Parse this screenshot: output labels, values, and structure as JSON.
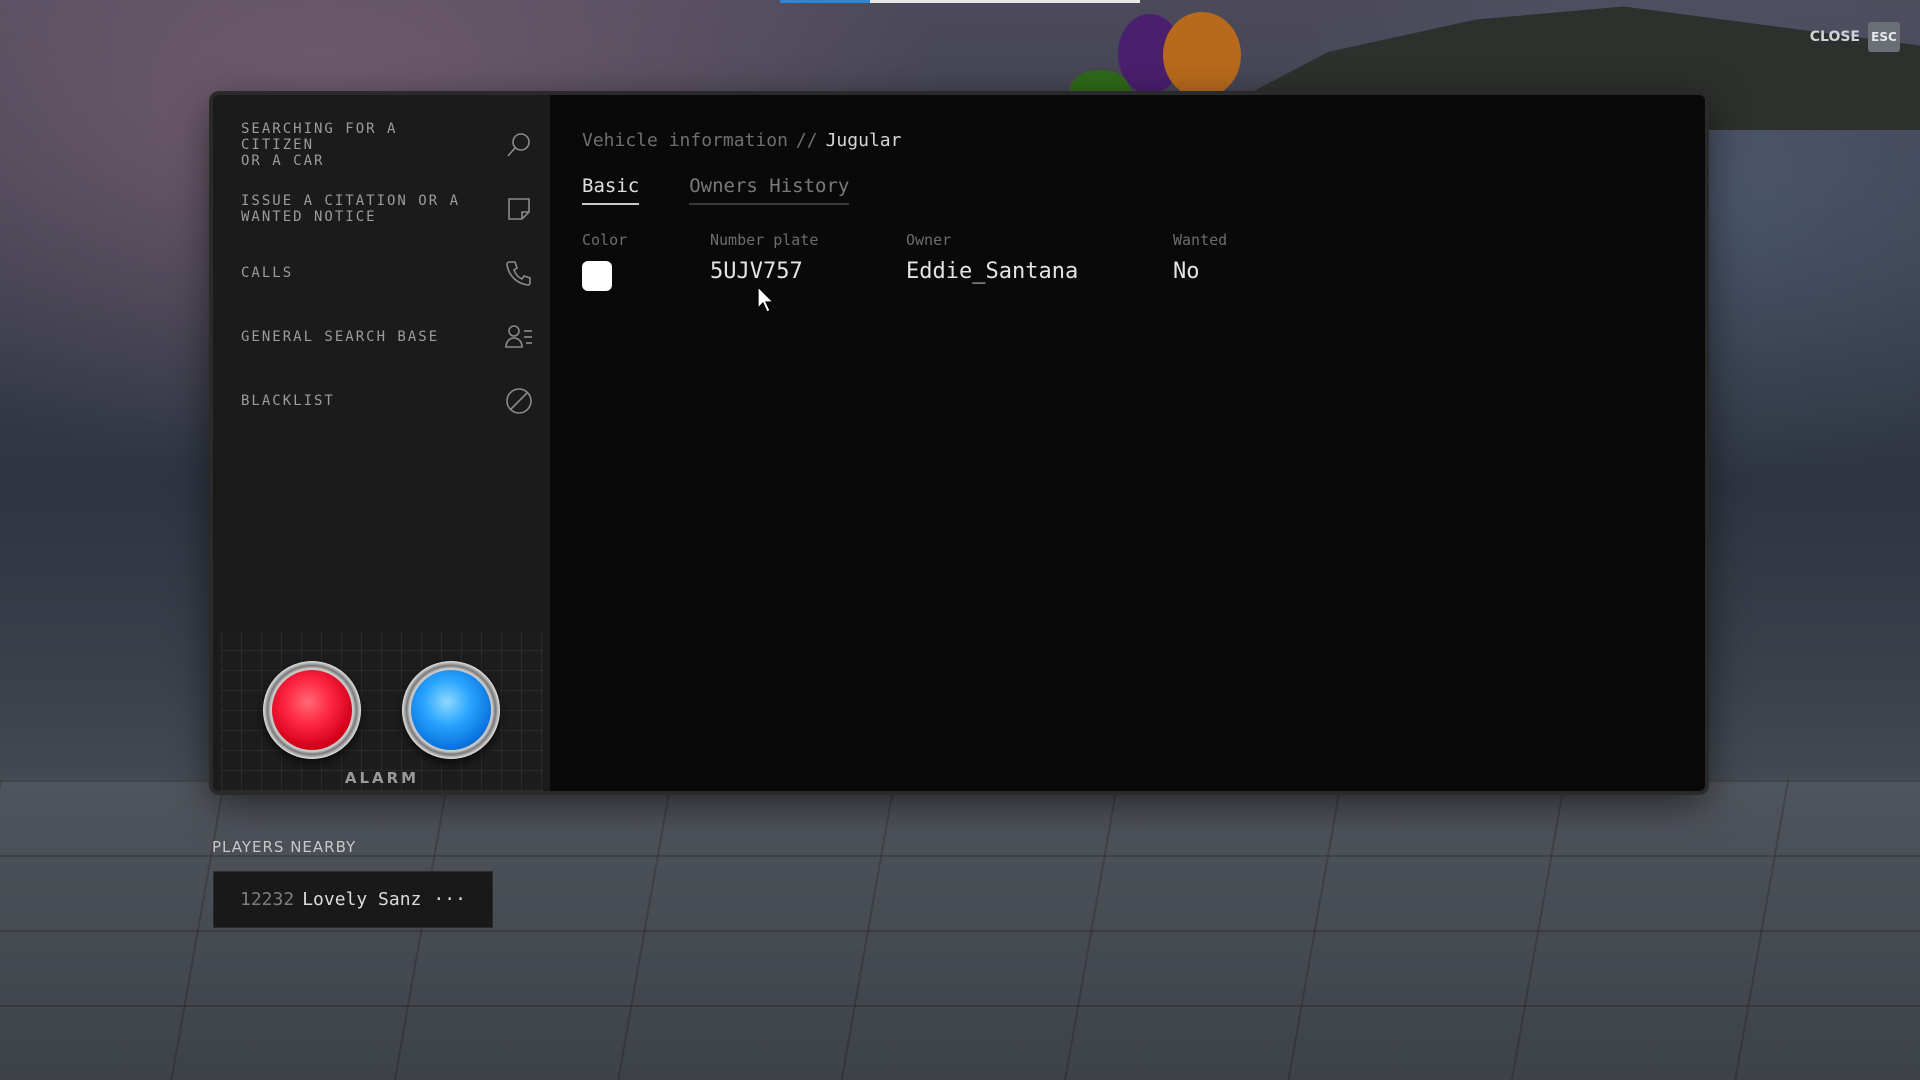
{
  "top_progress": {
    "fraction": 0.25,
    "color": "#2f86d6"
  },
  "close": {
    "label": "CLOSE",
    "key": "ESC"
  },
  "sidebar": {
    "items": [
      {
        "label": "SEARCHING FOR A\nCITIZEN\nOR A CAR",
        "icon": "search-icon"
      },
      {
        "label": "ISSUE A CITATION OR A\nWANTED NOTICE",
        "icon": "note-icon"
      },
      {
        "label": "CALLS",
        "icon": "phone-icon"
      },
      {
        "label": "GENERAL SEARCH BASE",
        "icon": "user-list-icon"
      },
      {
        "label": "BLACKLIST",
        "icon": "block-icon"
      }
    ],
    "alarm_label": "ALARM"
  },
  "main": {
    "breadcrumb": {
      "section": "Vehicle information",
      "separator": "//",
      "current": "Jugular"
    },
    "tabs": [
      {
        "label": "Basic",
        "active": true
      },
      {
        "label": "Owners History",
        "active": false
      }
    ],
    "fields": {
      "color_label": "Color",
      "color_value": "#ffffff",
      "plate_label": "Number plate",
      "plate_value": "5UJV757",
      "owner_label": "Owner",
      "owner_value": "Eddie_Santana",
      "wanted_label": "Wanted",
      "wanted_value": "No"
    }
  },
  "players_nearby": {
    "title": "PLAYERS NEARBY",
    "players": [
      {
        "id": "12232",
        "name": "Lovely Sanz",
        "more": "···"
      }
    ]
  }
}
